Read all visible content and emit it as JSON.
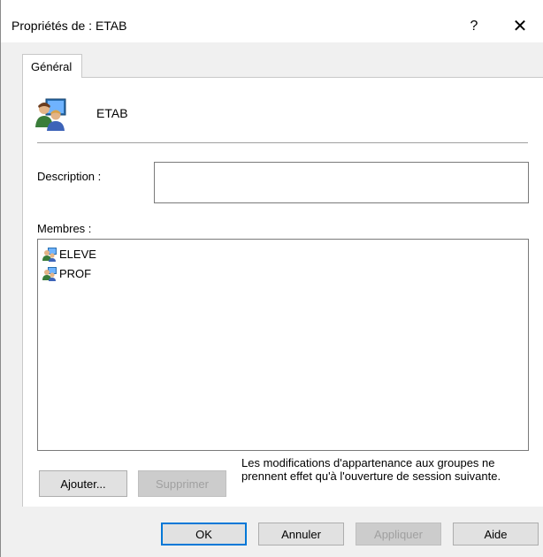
{
  "window": {
    "title": "Propriétés de : ETAB",
    "help": "?",
    "close": "✕"
  },
  "tabs": [
    {
      "label": "Général",
      "active": true
    }
  ],
  "group": {
    "name": "ETAB",
    "icon": "group-users-icon"
  },
  "description": {
    "label": "Description :",
    "value": "",
    "placeholder": ""
  },
  "members": {
    "label": "Membres :",
    "items": [
      {
        "name": "ELEVE",
        "icon": "group-icon"
      },
      {
        "name": "PROF",
        "icon": "group-icon"
      }
    ]
  },
  "actions": {
    "add": "Ajouter...",
    "remove": "Supprimer"
  },
  "note": "Les modifications d'appartenance aux groupes ne prennent effet qu'à l'ouverture de session suivante.",
  "footer": {
    "ok": "OK",
    "cancel": "Annuler",
    "apply": "Appliquer",
    "help": "Aide"
  },
  "colors": {
    "accent": "#0078d7",
    "disabled_text": "#a0a0a0"
  }
}
